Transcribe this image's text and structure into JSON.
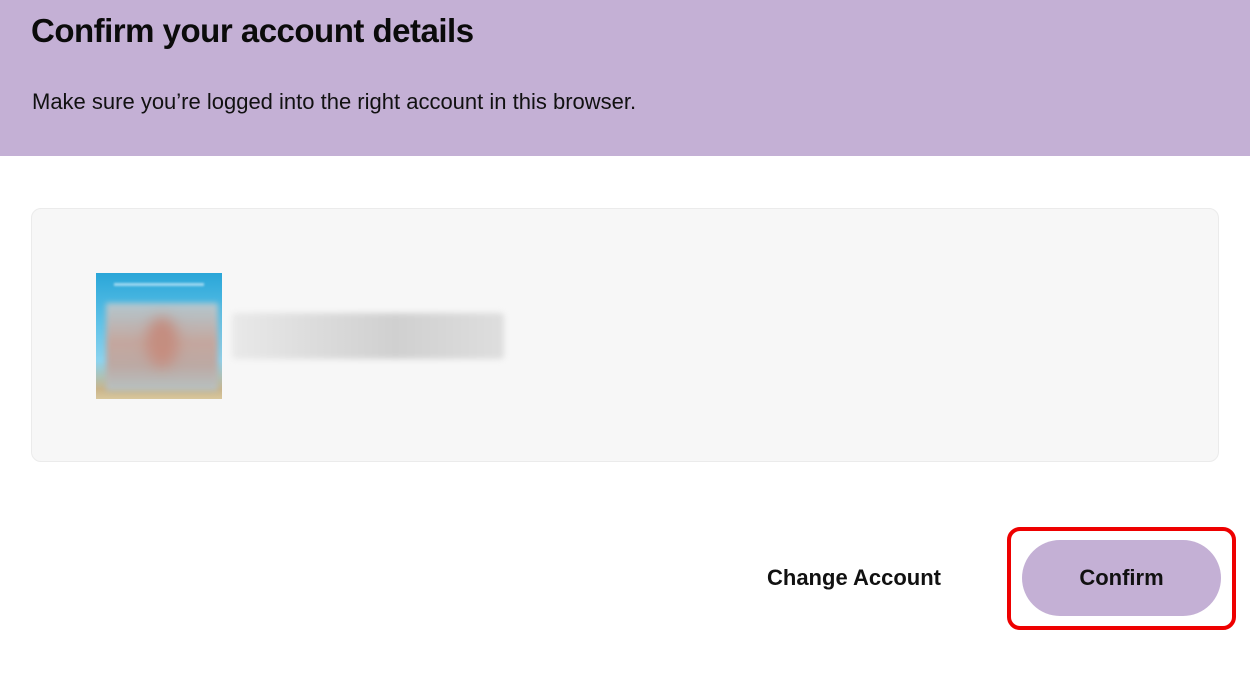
{
  "header": {
    "title": "Confirm your account details",
    "subtitle": "Make sure you’re logged into the right account in this browser."
  },
  "account": {
    "avatar": "profile-photo-blurred",
    "name": ""
  },
  "actions": {
    "change_account_label": "Change Account",
    "confirm_label": "Confirm"
  },
  "colors": {
    "accent": "#c4b0d5",
    "card_background": "#f7f7f7",
    "highlight": "#ee0000"
  }
}
